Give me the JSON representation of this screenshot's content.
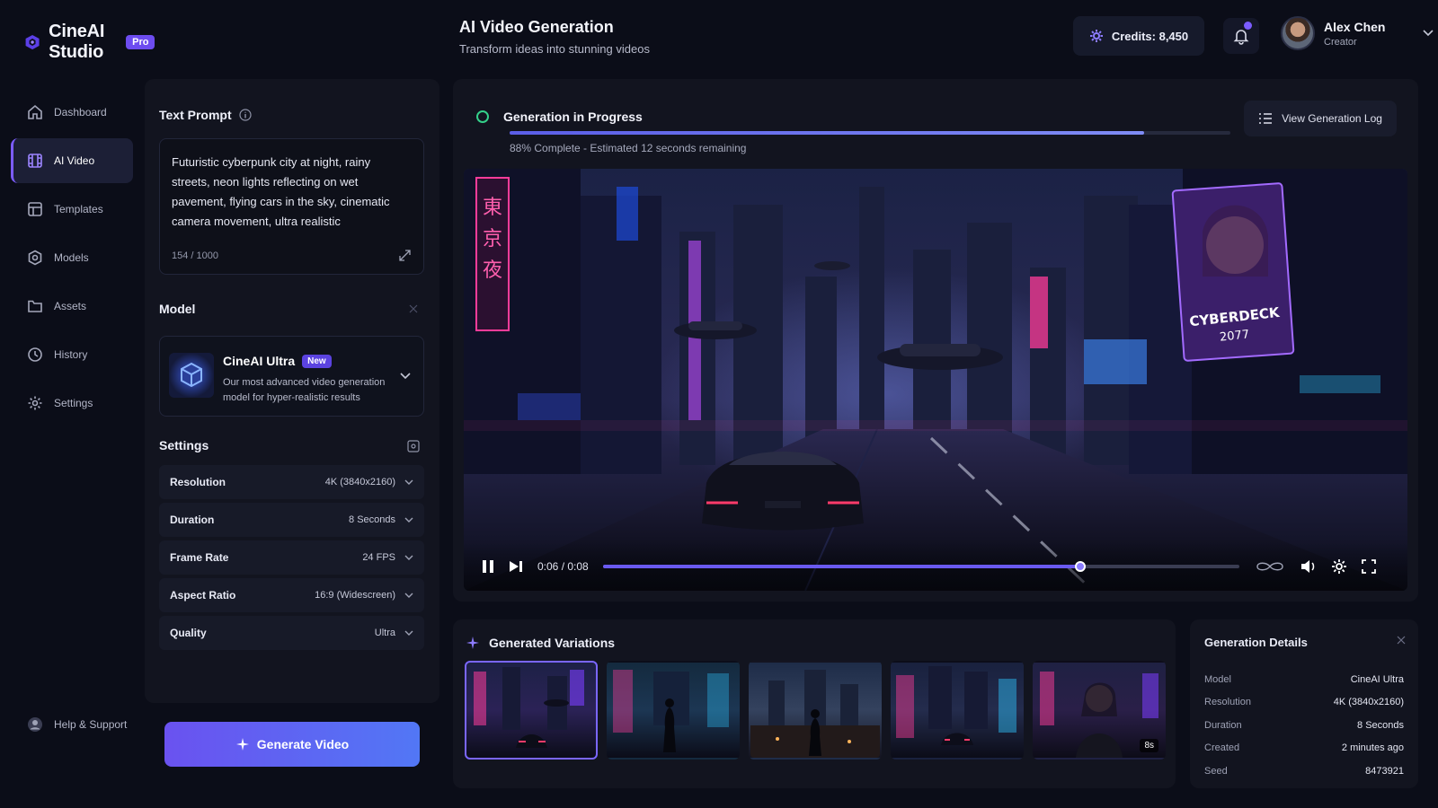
{
  "app": {
    "name": "CineAI Studio",
    "badge": "Pro"
  },
  "header": {
    "title": "AI Video Generation",
    "subtitle": "Transform ideas into stunning videos",
    "credits": "Credits: 8,450",
    "user": {
      "name": "Alex Chen",
      "role": "Creator"
    }
  },
  "sidebar": {
    "items": [
      {
        "label": "Dashboard",
        "icon": "home-icon"
      },
      {
        "label": "AI Video",
        "icon": "film-icon",
        "active": true
      },
      {
        "label": "Templates",
        "icon": "template-icon"
      },
      {
        "label": "Models",
        "icon": "gear-cube-icon"
      },
      {
        "label": "Assets",
        "icon": "folder-icon"
      },
      {
        "label": "History",
        "icon": "clock-icon"
      },
      {
        "label": "Settings",
        "icon": "gear-icon"
      }
    ],
    "help": "Help & Support"
  },
  "prompt": {
    "title": "Text Prompt",
    "text": "Futuristic cyberpunk city at night, rainy streets, neon lights reflecting on wet pavement, flying cars in the sky, cinematic camera movement, ultra realistic",
    "count": "154 / 1000"
  },
  "model": {
    "title": "Model",
    "name": "CineAI Ultra",
    "badge": "New",
    "desc": "Our most advanced video generation model for hyper-realistic results"
  },
  "settings": {
    "title": "Settings",
    "rows": [
      {
        "label": "Resolution",
        "value": "4K (3840x2160)"
      },
      {
        "label": "Duration",
        "value": "8 Seconds"
      },
      {
        "label": "Frame Rate",
        "value": "24 FPS"
      },
      {
        "label": "Aspect Ratio",
        "value": "16:9 (Widescreen)"
      },
      {
        "label": "Quality",
        "value": "Ultra"
      }
    ]
  },
  "generate_button": "Generate Video",
  "generation": {
    "status": "Generation in Progress",
    "progress": 0.88,
    "progress_text": "88% Complete - Estimated 12 seconds remaining",
    "log_button": "View Generation Log"
  },
  "player": {
    "time": "0:06 / 0:08",
    "position": 0.75,
    "billboard": "CYBERDECK 2077"
  },
  "variations": {
    "title": "Generated Variations",
    "last_badge": "8s"
  },
  "details": {
    "title": "Generation Details",
    "rows": [
      {
        "k": "Model",
        "v": "CineAI Ultra"
      },
      {
        "k": "Resolution",
        "v": "4K (3840x2160)"
      },
      {
        "k": "Duration",
        "v": "8 Seconds"
      },
      {
        "k": "Created",
        "v": "2 minutes ago"
      },
      {
        "k": "Seed",
        "v": "8473921"
      }
    ]
  },
  "colors": {
    "accent": "#7c5cff",
    "success": "#34d08a",
    "bg": "#0b0d18",
    "panel": "#12141f"
  }
}
